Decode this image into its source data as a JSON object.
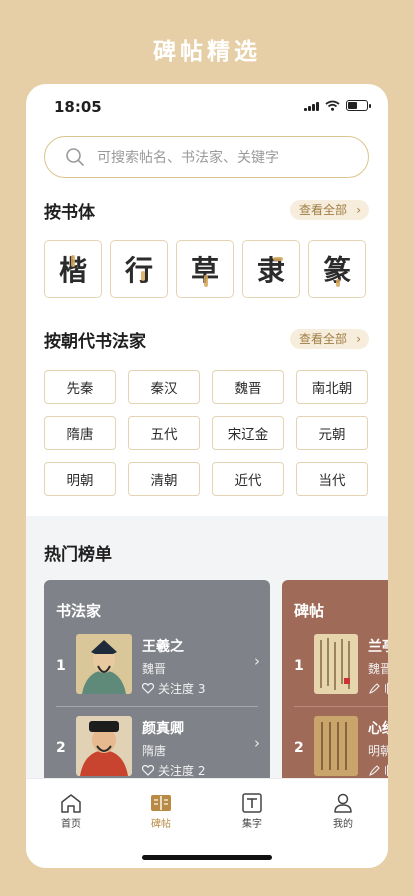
{
  "banner": {
    "title": "碑帖精选"
  },
  "status_bar": {
    "time": "18:05"
  },
  "search": {
    "placeholder": "可搜索帖名、书法家、关键字"
  },
  "by_script": {
    "title": "按书体",
    "see_all": "查看全部",
    "items": [
      "楷",
      "行",
      "草",
      "隶",
      "篆"
    ]
  },
  "by_dynasty": {
    "title": "按朝代书法家",
    "see_all": "查看全部",
    "items": [
      "先秦",
      "秦汉",
      "魏晋",
      "南北朝",
      "隋唐",
      "五代",
      "宋辽金",
      "元朝",
      "明朝",
      "清朝",
      "近代",
      "当代"
    ]
  },
  "hot": {
    "title": "热门榜单",
    "calligraphers": {
      "label": "书法家",
      "rows": [
        {
          "rank": "1",
          "name": "王羲之",
          "dynasty": "魏晋",
          "follow": "关注度 3"
        },
        {
          "rank": "2",
          "name": "颜真卿",
          "dynasty": "隋唐",
          "follow": "关注度 2"
        }
      ]
    },
    "works": {
      "label": "碑帖",
      "rows": [
        {
          "rank": "1",
          "name": "兰亭",
          "dynasty": "魏晋",
          "follow": "临"
        },
        {
          "rank": "2",
          "name": "心经",
          "dynasty": "明朝",
          "follow": "临"
        }
      ]
    }
  },
  "tabbar": {
    "items": [
      {
        "label": "首页",
        "icon": "home-icon"
      },
      {
        "label": "碑帖",
        "icon": "book-icon"
      },
      {
        "label": "集字",
        "icon": "text-icon"
      },
      {
        "label": "我的",
        "icon": "user-icon"
      }
    ]
  },
  "colors": {
    "accent": "#b88a43",
    "background": "#e6cfa6",
    "card_gray": "#7f8288",
    "card_brown": "#a06a58"
  }
}
